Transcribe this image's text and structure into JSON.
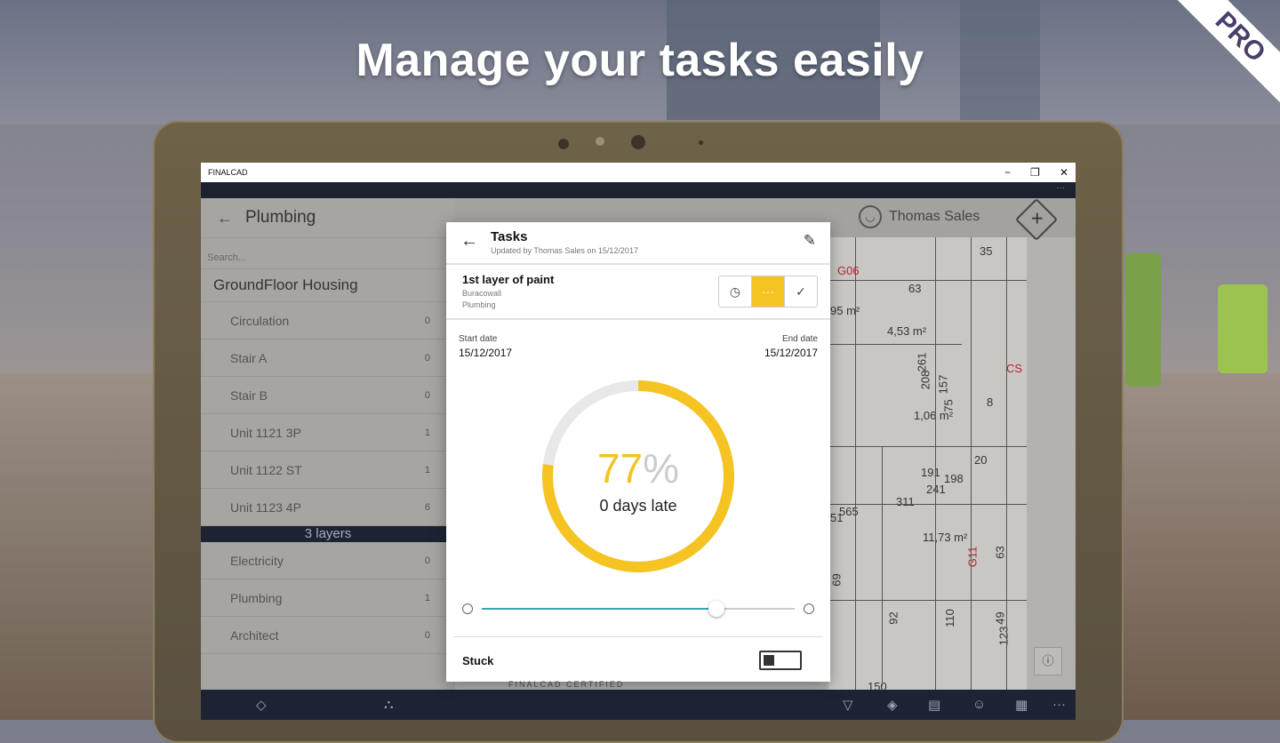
{
  "headline": "Manage your tasks easily",
  "badge": "PRO",
  "window": {
    "title": "FINALCAD",
    "min": "−",
    "max": "❐",
    "close": "✕",
    "more": "···"
  },
  "sidebar": {
    "title": "Plumbing",
    "search_placeholder": "Search...",
    "group": "GroundFloor Housing",
    "items": [
      {
        "label": "Circulation",
        "count": "0"
      },
      {
        "label": "Stair A",
        "count": "0"
      },
      {
        "label": "Stair B",
        "count": "0"
      },
      {
        "label": "Unit 1121 3P",
        "count": "1"
      },
      {
        "label": "Unit 1122 ST",
        "count": "1"
      },
      {
        "label": "Unit 1123 4P",
        "count": "6"
      }
    ],
    "layers_header": "3 layers",
    "layers": [
      {
        "label": "Electricity",
        "count": "0"
      },
      {
        "label": "Plumbing",
        "count": "1"
      },
      {
        "label": "Architect",
        "count": "0"
      }
    ]
  },
  "header": {
    "user": "Thomas Sales"
  },
  "plan_labels": [
    "35",
    "G06",
    "63",
    "95 m²",
    "4,53 m²",
    "261",
    "208",
    "157",
    "75",
    "1,06 m²",
    "8",
    "CS",
    "20",
    "191",
    "198",
    "241",
    "311",
    "565",
    "51",
    "11,73 m²",
    "G11",
    "63",
    "69",
    "92",
    "110",
    "49",
    "123",
    "150"
  ],
  "task_dialog": {
    "title": "Tasks",
    "subtitle": "Updated by Thomas Sales on 15/12/2017",
    "task_name": "1st layer of paint",
    "task_company": "Buracowall",
    "task_category": "Plumbing",
    "status_options": [
      "clock-icon",
      "···",
      "✓"
    ],
    "start_label": "Start date",
    "start_value": "15/12/2017",
    "end_label": "End date",
    "end_value": "15/12/2017",
    "progress_value": "77",
    "progress_symbol": "%",
    "progress_fraction": 0.77,
    "late_text": "0 days late",
    "slider_position": 0.75,
    "stuck_label": "Stuck",
    "stuck_on": false
  },
  "certified": "FINALCAD CERTIFIED",
  "colors": {
    "accent": "#f5c322",
    "slider": "#3aa7b0",
    "dark": "#1c2434"
  }
}
